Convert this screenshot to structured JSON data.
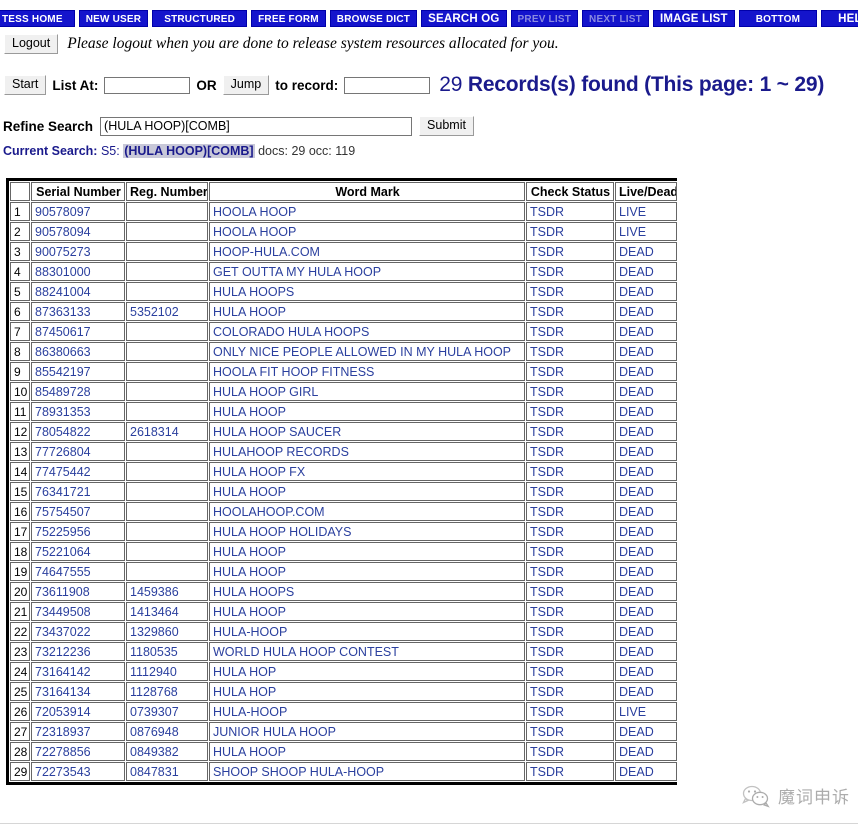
{
  "nav": {
    "buttons": [
      {
        "label": "TESS Home",
        "name": "nav-tess-home",
        "disabled": false,
        "style": "smallcaps"
      },
      {
        "label": "New User",
        "name": "nav-new-user",
        "disabled": false,
        "style": "smallcaps"
      },
      {
        "label": "Structured",
        "name": "nav-structured",
        "disabled": false,
        "style": "smallcaps"
      },
      {
        "label": "Free Form",
        "name": "nav-free-form",
        "disabled": false,
        "style": "smallcaps"
      },
      {
        "label": "Browse Dict",
        "name": "nav-browse-dict",
        "disabled": false,
        "style": "smallcaps"
      },
      {
        "label": "SEARCH OG",
        "name": "nav-search-og",
        "disabled": false,
        "style": "plain"
      },
      {
        "label": "Prev List",
        "name": "nav-prev-list",
        "disabled": true,
        "style": "smallcaps"
      },
      {
        "label": "Next List",
        "name": "nav-next-list",
        "disabled": true,
        "style": "smallcaps"
      },
      {
        "label": "IMAGE LIST",
        "name": "nav-image-list",
        "disabled": false,
        "style": "plain"
      },
      {
        "label": "Bottom",
        "name": "nav-bottom",
        "disabled": false,
        "style": "smallcaps"
      },
      {
        "label": "HELP",
        "name": "nav-help",
        "disabled": false,
        "style": "plain"
      }
    ]
  },
  "logout": {
    "button_label": "Logout",
    "message": "Please logout when you are done to release system resources allocated for you."
  },
  "listat": {
    "start_label": "Start",
    "list_at_label": "List At:",
    "list_at_value": "",
    "or_label": "OR",
    "jump_label": "Jump",
    "to_record_label": "to record:",
    "record_value": "",
    "records_count": "29",
    "records_found_text": "Records(s) found (This page: 1 ~ 29)"
  },
  "refine": {
    "label": "Refine Search",
    "value": "(HULA HOOP)[COMB]",
    "placeholder": "",
    "submit_label": "Submit"
  },
  "current_search": {
    "label": "Current Search:",
    "session": "S5:",
    "query": "(HULA HOOP)[COMB]",
    "stats": "docs: 29 occ: 119"
  },
  "table": {
    "headers": [
      "",
      "Serial Number",
      "Reg. Number",
      "Word Mark",
      "Check Status",
      "Live/Dead"
    ],
    "rows": [
      {
        "n": "1",
        "serial": "90578097",
        "reg": "",
        "mark": "HOOLA HOOP",
        "check": "TSDR",
        "live": "LIVE"
      },
      {
        "n": "2",
        "serial": "90578094",
        "reg": "",
        "mark": "HOOLA HOOP",
        "check": "TSDR",
        "live": "LIVE"
      },
      {
        "n": "3",
        "serial": "90075273",
        "reg": "",
        "mark": "HOOP-HULA.COM",
        "check": "TSDR",
        "live": "DEAD"
      },
      {
        "n": "4",
        "serial": "88301000",
        "reg": "",
        "mark": "GET OUTTA MY HULA HOOP",
        "check": "TSDR",
        "live": "DEAD"
      },
      {
        "n": "5",
        "serial": "88241004",
        "reg": "",
        "mark": "HULA HOOPS",
        "check": "TSDR",
        "live": "DEAD"
      },
      {
        "n": "6",
        "serial": "87363133",
        "reg": "5352102",
        "mark": "HULA HOOP",
        "check": "TSDR",
        "live": "DEAD"
      },
      {
        "n": "7",
        "serial": "87450617",
        "reg": "",
        "mark": "COLORADO HULA HOOPS",
        "check": "TSDR",
        "live": "DEAD"
      },
      {
        "n": "8",
        "serial": "86380663",
        "reg": "",
        "mark": "ONLY NICE PEOPLE ALLOWED IN MY HULA HOOP",
        "check": "TSDR",
        "live": "DEAD"
      },
      {
        "n": "9",
        "serial": "85542197",
        "reg": "",
        "mark": "HOOLA FIT HOOP FITNESS",
        "check": "TSDR",
        "live": "DEAD"
      },
      {
        "n": "10",
        "serial": "85489728",
        "reg": "",
        "mark": "HULA HOOP GIRL",
        "check": "TSDR",
        "live": "DEAD"
      },
      {
        "n": "11",
        "serial": "78931353",
        "reg": "",
        "mark": "HULA HOOP",
        "check": "TSDR",
        "live": "DEAD"
      },
      {
        "n": "12",
        "serial": "78054822",
        "reg": "2618314",
        "mark": "HULA HOOP SAUCER",
        "check": "TSDR",
        "live": "DEAD"
      },
      {
        "n": "13",
        "serial": "77726804",
        "reg": "",
        "mark": "HULAHOOP RECORDS",
        "check": "TSDR",
        "live": "DEAD"
      },
      {
        "n": "14",
        "serial": "77475442",
        "reg": "",
        "mark": "HULA HOOP FX",
        "check": "TSDR",
        "live": "DEAD"
      },
      {
        "n": "15",
        "serial": "76341721",
        "reg": "",
        "mark": "HULA HOOP",
        "check": "TSDR",
        "live": "DEAD"
      },
      {
        "n": "16",
        "serial": "75754507",
        "reg": "",
        "mark": "HOOLAHOOP.COM",
        "check": "TSDR",
        "live": "DEAD"
      },
      {
        "n": "17",
        "serial": "75225956",
        "reg": "",
        "mark": "HULA HOOP HOLIDAYS",
        "check": "TSDR",
        "live": "DEAD"
      },
      {
        "n": "18",
        "serial": "75221064",
        "reg": "",
        "mark": "HULA HOOP",
        "check": "TSDR",
        "live": "DEAD"
      },
      {
        "n": "19",
        "serial": "74647555",
        "reg": "",
        "mark": "HULA HOOP",
        "check": "TSDR",
        "live": "DEAD"
      },
      {
        "n": "20",
        "serial": "73611908",
        "reg": "1459386",
        "mark": "HULA HOOPS",
        "check": "TSDR",
        "live": "DEAD"
      },
      {
        "n": "21",
        "serial": "73449508",
        "reg": "1413464",
        "mark": "HULA HOOP",
        "check": "TSDR",
        "live": "DEAD"
      },
      {
        "n": "22",
        "serial": "73437022",
        "reg": "1329860",
        "mark": "HULA-HOOP",
        "check": "TSDR",
        "live": "DEAD"
      },
      {
        "n": "23",
        "serial": "73212236",
        "reg": "1180535",
        "mark": "WORLD HULA HOOP CONTEST",
        "check": "TSDR",
        "live": "DEAD"
      },
      {
        "n": "24",
        "serial": "73164142",
        "reg": "1112940",
        "mark": "HULA HOP",
        "check": "TSDR",
        "live": "DEAD"
      },
      {
        "n": "25",
        "serial": "73164134",
        "reg": "1128768",
        "mark": "HULA HOP",
        "check": "TSDR",
        "live": "DEAD"
      },
      {
        "n": "26",
        "serial": "72053914",
        "reg": "0739307",
        "mark": "HULA-HOOP",
        "check": "TSDR",
        "live": "LIVE"
      },
      {
        "n": "27",
        "serial": "72318937",
        "reg": "0876948",
        "mark": "JUNIOR HULA HOOP",
        "check": "TSDR",
        "live": "DEAD"
      },
      {
        "n": "28",
        "serial": "72278856",
        "reg": "0849382",
        "mark": "HULA HOOP",
        "check": "TSDR",
        "live": "DEAD"
      },
      {
        "n": "29",
        "serial": "72273543",
        "reg": "0847831",
        "mark": "SHOOP SHOOP HULA-HOOP",
        "check": "TSDR",
        "live": "DEAD"
      }
    ]
  },
  "watermark": {
    "icon": "wechat-icon",
    "text": "魔词申诉"
  },
  "colors": {
    "nav_blue": "#1414cc",
    "nav_disabled_text": "#8a8ae0",
    "link_blue": "#2a3f9e",
    "heading_blue": "#1a1a8c",
    "highlight_gray": "#c8c8d8"
  }
}
